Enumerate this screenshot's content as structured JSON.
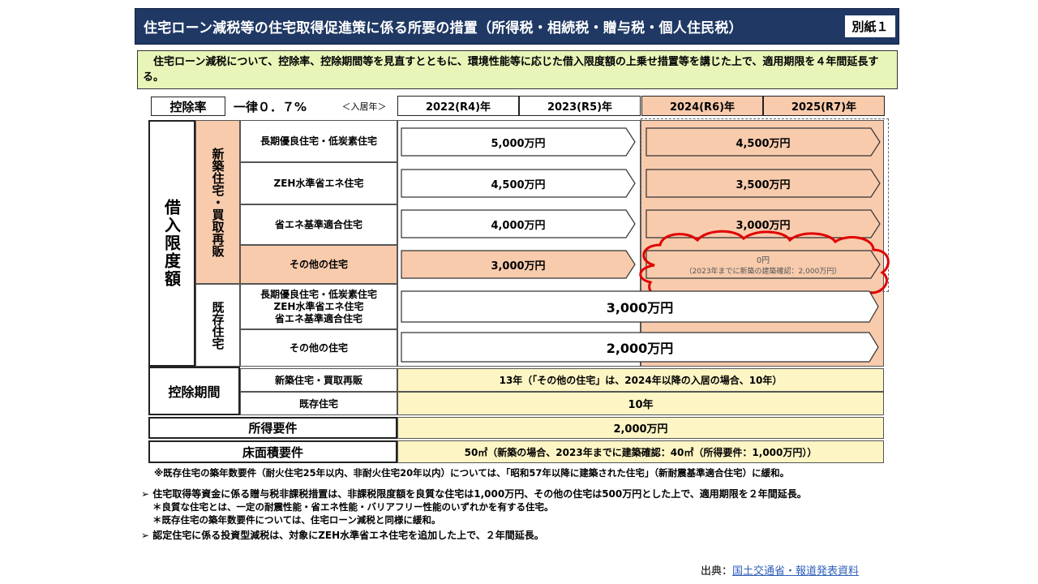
{
  "title": {
    "text": "住宅ローン減税等の住宅取得促進策に係る所要の措置（所得税・相続税・贈与税・個人住民税）",
    "badge": "別紙１"
  },
  "summary": "　住宅ローン減税について、控除率、控除期間等を見直すとともに、環境性能等に応じた借入限度額の上乗せ措置等を講じた上で、適用期限を４年間延長する。",
  "header": {
    "rate_label": "控除率",
    "rate_value": "一律０．７%",
    "move_in": "＜入居年＞",
    "years": [
      "2022(R4)年",
      "2023(R5)年",
      "2024(R6)年",
      "2025(R7)年"
    ]
  },
  "table": {
    "loan_cap_label": "借入限度額",
    "new_group_label": "新築住宅・買取再販",
    "existing_group_label": "既存住宅",
    "rows": [
      {
        "label": "長期優良住宅・低炭素住宅",
        "value_early": "5,000万円",
        "value_late": "4,500万円"
      },
      {
        "label": "ZEH水準省エネ住宅",
        "value_early": "4,500万円",
        "value_late": "3,500万円"
      },
      {
        "label": "省エネ基準適合住宅",
        "value_early": "4,000万円",
        "value_late": "3,000万円"
      },
      {
        "label": "その他の住宅",
        "value_early": "3,000万円",
        "value_late": "0円",
        "value_late_note": "（2023年までに新築の建築確認：2,000万円）"
      }
    ],
    "existing_rows": [
      {
        "label_lines": [
          "長期優良住宅・低炭素住宅",
          "ZEH水準省エネ住宅",
          "省エネ基準適合住宅"
        ],
        "value": "3,000万円"
      },
      {
        "label": "その他の住宅",
        "value": "2,000万円"
      }
    ]
  },
  "period": {
    "label": "控除期間",
    "sub_new": "新築住宅・買取再販",
    "sub_existing": "既存住宅",
    "value_new": "13年（「その他の住宅」は、2024年以降の入居の場合、10年）",
    "value_existing": "10年"
  },
  "income": {
    "label": "所得要件",
    "value": "2,000万円"
  },
  "floor": {
    "label": "床面積要件",
    "value": "50㎡（新築の場合、2023年までに建築確認：40㎡（所得要件：1,000万円））"
  },
  "notes": [
    "※既存住宅の築年数要件（耐火住宅25年以内、非耐火住宅20年以内）については、「昭和57年以降に建築された住宅」（新耐震基準適合住宅）に緩和。",
    "➢ 住宅取得等資金に係る贈与税非課税措置は、非課税限度額を良質な住宅は1,000万円、その他の住宅は500万円とした上で、適用期限を２年間延長。",
    "＊良質な住宅とは、一定の耐震性能・省エネ性能・バリアフリー性能のいずれかを有する住宅。",
    "＊既存住宅の築年数要件については、住宅ローン減税と同様に緩和。",
    "➢ 認定住宅に係る投資型減税は、対象にZEH水準省エネ住宅を追加した上で、２年間延長。"
  ],
  "source": {
    "label": "出典：",
    "link": "国土交通省・報道発表資料"
  },
  "colors": {
    "title_bg": "#1f3864",
    "summary_bg": "#e8f5b8",
    "salmon": "#f8cbad",
    "yellow": "#fdf5c4",
    "highlight_cloud": "#e00000"
  }
}
